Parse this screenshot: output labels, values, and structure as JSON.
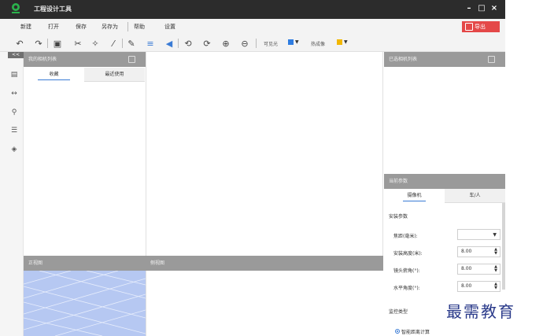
{
  "app": {
    "title": "工程设计工具"
  },
  "window_controls": {
    "minimize": "–",
    "maximize": "□",
    "close": "×"
  },
  "menu": {
    "items": [
      "新建",
      "打开",
      "保存",
      "另存为",
      "帮助",
      "设置"
    ],
    "export_label": "导出"
  },
  "toolbar": {
    "visible_label": "可见光",
    "thermal_label": "热成像",
    "visible_color": "#2f7de1",
    "thermal_color": "#f2b700"
  },
  "left_panel": {
    "collapse_label": "<<",
    "title": "我的相机列表",
    "tabs": [
      "收藏",
      "最近使用"
    ]
  },
  "views": {
    "front_title": "正视图",
    "side_title": "侧视图"
  },
  "right_panel": {
    "title": "已选相机列表",
    "params_title": "当前参数",
    "tabs": [
      "摄像机",
      "车/人"
    ],
    "install_section": "安装参数",
    "fields": [
      {
        "label": "焦距(毫米):",
        "value": ""
      },
      {
        "label": "安装高度(米):",
        "value": "8.00"
      },
      {
        "label": "镜头俯角(°):",
        "value": "8.00"
      },
      {
        "label": "水平角度(°):",
        "value": "8.00"
      }
    ],
    "monitor_section": "监控类型",
    "radio_label": "智能距离计算"
  },
  "watermark": "最需教育",
  "colors": {
    "accent": "#3a7bd5",
    "export": "#e44848",
    "titlebar": "#2c2c2c"
  }
}
